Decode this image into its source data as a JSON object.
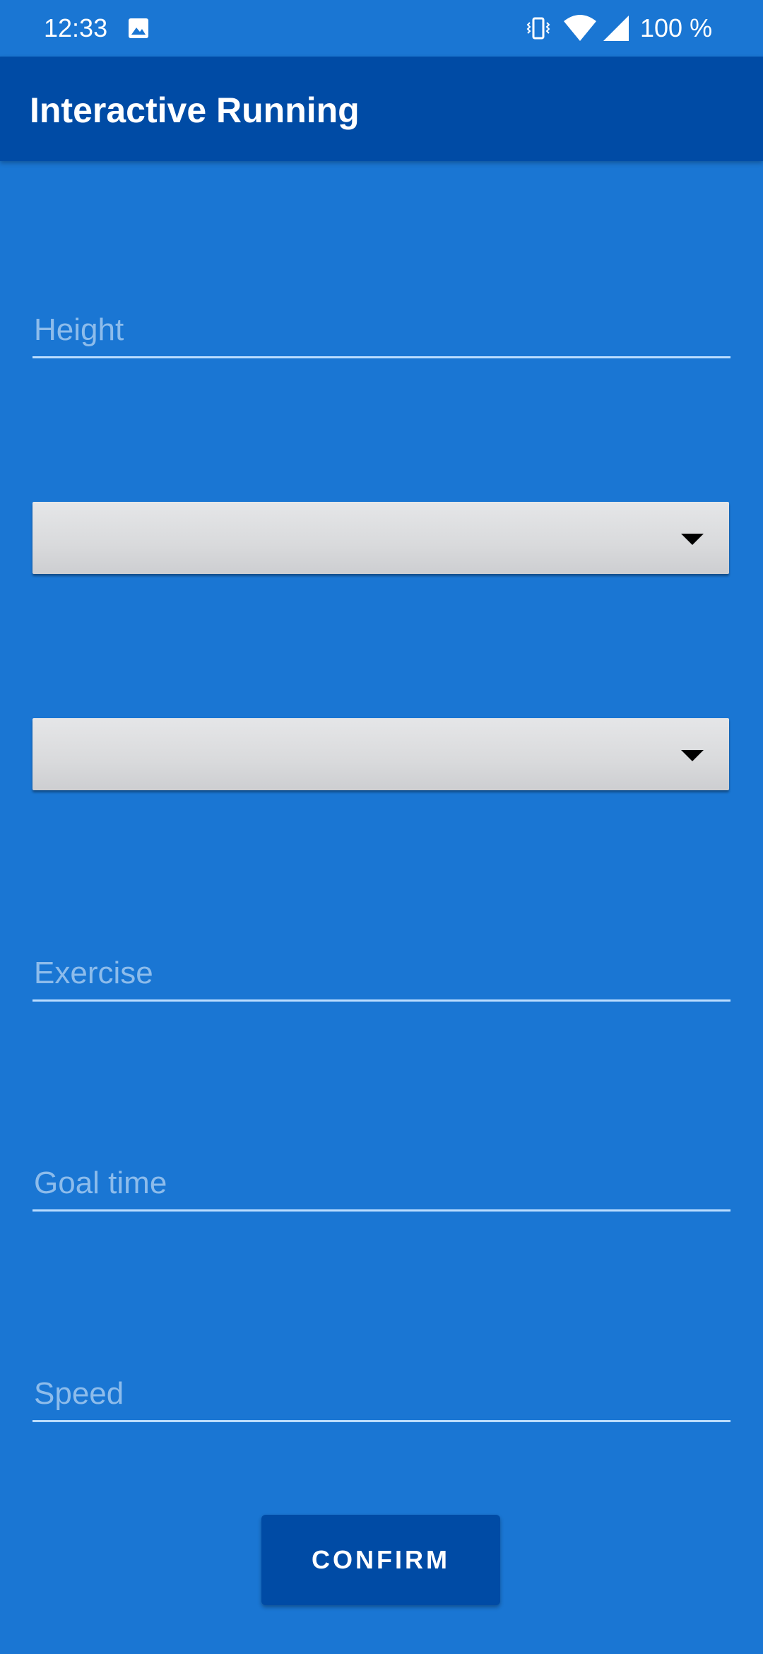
{
  "status_bar": {
    "time": "12:33",
    "battery": "100 %",
    "icons": [
      "gallery-icon",
      "vibrate-icon",
      "wifi-icon",
      "signal-icon"
    ]
  },
  "app_bar": {
    "title": "Interactive Running"
  },
  "form": {
    "height_placeholder": "Height",
    "spinner_1_value": "",
    "spinner_2_value": "",
    "exercise_placeholder": "Exercise",
    "goal_time_placeholder": "Goal time",
    "speed_placeholder": "Speed"
  },
  "confirm_label": "CONFIRM",
  "colors": {
    "background": "#1A76D3",
    "app_bar": "#004BA5",
    "button": "#004BA5",
    "placeholder": "#8DBCEB",
    "underline": "#BBDDFF",
    "spinner": "#DDDEE0"
  }
}
